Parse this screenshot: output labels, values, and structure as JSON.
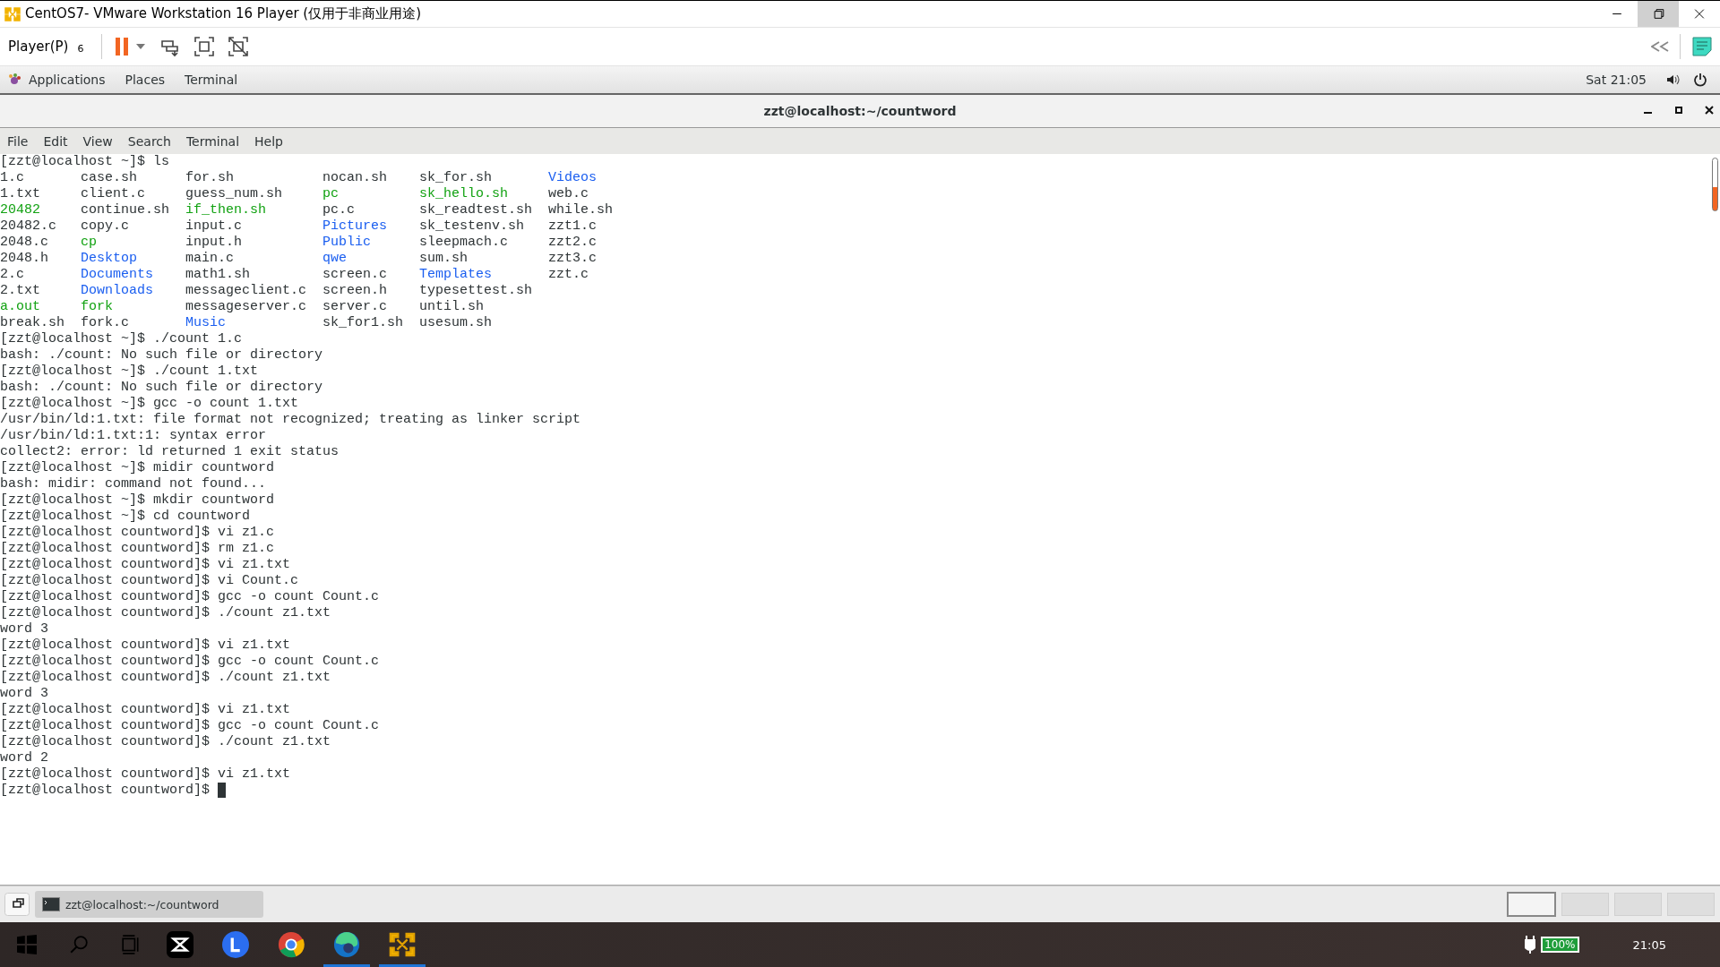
{
  "window": {
    "title": "CentOS7- VMware Workstation 16 Player (仅用于非商业用途)"
  },
  "toolbar": {
    "menu": "Player(P)",
    "badge": "6"
  },
  "top_bar": {
    "menus": [
      "Applications",
      "Places",
      "Terminal"
    ],
    "clock": "Sat 21:05"
  },
  "terminal": {
    "title": "zzt@localhost:~/countword",
    "menu": [
      "File",
      "Edit",
      "View",
      "Search",
      "Terminal",
      "Help"
    ],
    "ls_command": "[zzt@localhost ~]$ ls",
    "listing": [
      [
        {
          "name": "1.c",
          "kind": "file"
        },
        {
          "name": "case.sh",
          "kind": "file"
        },
        {
          "name": "for.sh",
          "kind": "file"
        },
        {
          "name": "nocan.sh",
          "kind": "file"
        },
        {
          "name": "sk_for.sh",
          "kind": "file"
        },
        {
          "name": "Videos",
          "kind": "dir"
        }
      ],
      [
        {
          "name": "1.txt",
          "kind": "file"
        },
        {
          "name": "client.c",
          "kind": "file"
        },
        {
          "name": "guess_num.sh",
          "kind": "file"
        },
        {
          "name": "pc",
          "kind": "exec"
        },
        {
          "name": "sk_hello.sh",
          "kind": "exec"
        },
        {
          "name": "web.c",
          "kind": "file"
        }
      ],
      [
        {
          "name": "20482",
          "kind": "exec"
        },
        {
          "name": "continue.sh",
          "kind": "file"
        },
        {
          "name": "if_then.sh",
          "kind": "exec"
        },
        {
          "name": "pc.c",
          "kind": "file"
        },
        {
          "name": "sk_readtest.sh",
          "kind": "file"
        },
        {
          "name": "while.sh",
          "kind": "file"
        }
      ],
      [
        {
          "name": "20482.c",
          "kind": "file"
        },
        {
          "name": "copy.c",
          "kind": "file"
        },
        {
          "name": "input.c",
          "kind": "file"
        },
        {
          "name": "Pictures",
          "kind": "dir"
        },
        {
          "name": "sk_testenv.sh",
          "kind": "file"
        },
        {
          "name": "zzt1.c",
          "kind": "file"
        }
      ],
      [
        {
          "name": "2048.c",
          "kind": "file"
        },
        {
          "name": "cp",
          "kind": "exec"
        },
        {
          "name": "input.h",
          "kind": "file"
        },
        {
          "name": "Public",
          "kind": "dir"
        },
        {
          "name": "sleepmach.c",
          "kind": "file"
        },
        {
          "name": "zzt2.c",
          "kind": "file"
        }
      ],
      [
        {
          "name": "2048.h",
          "kind": "file"
        },
        {
          "name": "Desktop",
          "kind": "dir"
        },
        {
          "name": "main.c",
          "kind": "file"
        },
        {
          "name": "qwe",
          "kind": "dir"
        },
        {
          "name": "sum.sh",
          "kind": "file"
        },
        {
          "name": "zzt3.c",
          "kind": "file"
        }
      ],
      [
        {
          "name": "2.c",
          "kind": "file"
        },
        {
          "name": "Documents",
          "kind": "dir"
        },
        {
          "name": "math1.sh",
          "kind": "file"
        },
        {
          "name": "screen.c",
          "kind": "file"
        },
        {
          "name": "Templates",
          "kind": "dir"
        },
        {
          "name": "zzt.c",
          "kind": "file"
        }
      ],
      [
        {
          "name": "2.txt",
          "kind": "file"
        },
        {
          "name": "Downloads",
          "kind": "dir"
        },
        {
          "name": "messageclient.c",
          "kind": "file"
        },
        {
          "name": "screen.h",
          "kind": "file"
        },
        {
          "name": "typesettest.sh",
          "kind": "file"
        }
      ],
      [
        {
          "name": "a.out",
          "kind": "exec"
        },
        {
          "name": "fork",
          "kind": "exec"
        },
        {
          "name": "messageserver.c",
          "kind": "file"
        },
        {
          "name": "server.c",
          "kind": "file"
        },
        {
          "name": "until.sh",
          "kind": "file"
        }
      ],
      [
        {
          "name": "break.sh",
          "kind": "file"
        },
        {
          "name": "fork.c",
          "kind": "file"
        },
        {
          "name": "Music",
          "kind": "dir"
        },
        {
          "name": "sk_for1.sh",
          "kind": "file"
        },
        {
          "name": "usesum.sh",
          "kind": "file"
        }
      ]
    ],
    "lines": [
      "[zzt@localhost ~]$ ./count 1.c",
      "bash: ./count: No such file or directory",
      "[zzt@localhost ~]$ ./count 1.txt",
      "bash: ./count: No such file or directory",
      "[zzt@localhost ~]$ gcc -o count 1.txt",
      "/usr/bin/ld:1.txt: file format not recognized; treating as linker script",
      "/usr/bin/ld:1.txt:1: syntax error",
      "collect2: error: ld returned 1 exit status",
      "[zzt@localhost ~]$ midir countword",
      "bash: midir: command not found...",
      "[zzt@localhost ~]$ mkdir countword",
      "[zzt@localhost ~]$ cd countword",
      "[zzt@localhost countword]$ vi z1.c",
      "[zzt@localhost countword]$ rm z1.c",
      "[zzt@localhost countword]$ vi z1.txt",
      "[zzt@localhost countword]$ vi Count.c",
      "[zzt@localhost countword]$ gcc -o count Count.c",
      "[zzt@localhost countword]$ ./count z1.txt",
      "word 3",
      "[zzt@localhost countword]$ vi z1.txt",
      "[zzt@localhost countword]$ gcc -o count Count.c",
      "[zzt@localhost countword]$ ./count z1.txt",
      "word 3",
      "[zzt@localhost countword]$ vi z1.txt",
      "[zzt@localhost countword]$ gcc -o count Count.c",
      "[zzt@localhost countword]$ ./count z1.txt",
      "word 2",
      "[zzt@localhost countword]$ vi z1.txt"
    ],
    "prompt": "[zzt@localhost countword]$"
  },
  "bottom_panel": {
    "task": "zzt@localhost:~/countword",
    "workspaces": [
      {
        "selected": true
      },
      {
        "selected": false
      },
      {
        "selected": false
      },
      {
        "selected": false
      }
    ]
  },
  "taskbar": {
    "apps": [
      {
        "active": false
      },
      {
        "active": false
      },
      {
        "active": false
      },
      {
        "active": true
      },
      {
        "active": true
      }
    ],
    "battery": "100%",
    "clock": "21:05"
  }
}
